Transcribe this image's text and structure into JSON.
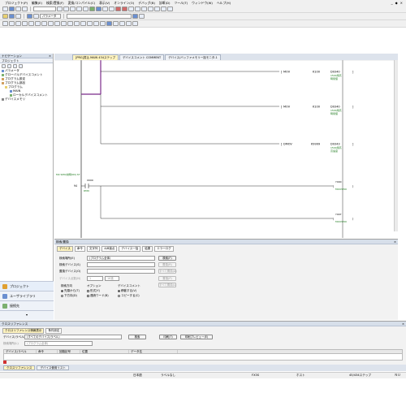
{
  "menu": [
    "プロジェクト(P)",
    "編集(E)",
    "検索/置換(F)",
    "変換/コンパイル(C)",
    "表示(V)",
    "オンライン(O)",
    "デバッグ(B)",
    "診断(D)",
    "ツール(T)",
    "ウィンドウ(W)",
    "ヘルプ(H)"
  ],
  "window_controls": [
    "_",
    "◆",
    "×"
  ],
  "toolbar": {
    "param_label": "パラメータ",
    "dropdown_empty": ""
  },
  "navigation": {
    "title": "ナビゲーション",
    "close": "×",
    "section": "プロジェクト",
    "tree": [
      {
        "label": "パラメータ",
        "level": 1
      },
      {
        "label": "グローバルデバイスコメント",
        "level": 1
      },
      {
        "label": "プログラム設定",
        "level": 1
      },
      {
        "label": "プログラム部品",
        "level": 1
      },
      {
        "label": "プログラム",
        "level": 2
      },
      {
        "label": "MAIN",
        "level": 3
      },
      {
        "label": "ローカルデバイスコメント",
        "level": 3
      },
      {
        "label": "デバイスメモリ",
        "level": 1
      }
    ],
    "buttons": [
      "プロジェクト",
      "ユーザライブラリ",
      "接続先"
    ]
  },
  "editor": {
    "tabs": [
      {
        "label": "[PRG]書込 MAIN 434ステップ",
        "active": true
      },
      {
        "label": "デバイスコメント COMMENT",
        "active": false
      },
      {
        "label": "デバイス/バッファメモリ一括モニタ-1",
        "active": false
      }
    ],
    "rungs": [
      {
        "instr": "MOV",
        "src": "K100",
        "dst": "D0340",
        "comment1": "1500用高",
        "comment2": "時間値"
      },
      {
        "instr": "MOV",
        "src": "K100",
        "dst": "D0340",
        "comment1": "1500用高",
        "comment2": "時間値"
      },
      {
        "instr": "DMOV",
        "src": "K9999",
        "dst": "D0343",
        "comment1": "1500用高",
        "comment2": "高速度"
      }
    ],
    "step_label": "M0 SM0(常時ON) ST",
    "contact_addr": "X000",
    "contact_comment": "RMO",
    "step_no": "94",
    "coil1": "Y000",
    "coil1_comment": "MOUSMO",
    "coil2": "Y007",
    "coil2_comment": "MOUSMO"
  },
  "search": {
    "title": "検索/置換",
    "close": "×",
    "tabs": [
      "デバイス",
      "命令",
      "文字列",
      "A/B接点",
      "デバイス一括",
      "結果",
      "エラーログ"
    ],
    "target_label": "検索場所(E)",
    "target_value": "(プログラム全体)",
    "find_device_label": "検索デバイス(S)",
    "replace_device_label": "置換デバイス(O)",
    "count_label": "デバイス点数(N)",
    "count_value": "1",
    "count_unit": "16進",
    "direction_label": "検索方向",
    "direction_options": [
      "先頭から(T)",
      "下方向(D)"
    ],
    "options_label": "オプション",
    "option_items": [
      "形式(Y)",
      "連続ワード(B)"
    ],
    "comment_label": "デバイスコメント",
    "comment_items": [
      "移動する(V)",
      "コピーする(C)"
    ],
    "buttons": {
      "find_next": "検索(F)",
      "replace": "置換(R)",
      "replace_all": "すべて置換(A)",
      "replace_btn2": "置換(P)",
      "replace_all2": "すべて置換(L)"
    }
  },
  "xref": {
    "title": "クロスリファレンス",
    "close": "×",
    "subtabs": [
      "クロスリファレンス情報表示",
      "条件設定"
    ],
    "device_label": "デバイス/ラベル(D)",
    "device_value": "(すべてのデバイス/ラベル)",
    "find_button": "検索",
    "print_button": "印刷(T)",
    "preview_button": "印刷プレビュー(E)",
    "place_label": "検索場所(L)",
    "place_value": "(プログラム全体)",
    "columns": [
      "デバイス/ラベル",
      "命令",
      "回路記号",
      "位置",
      "データ名"
    ]
  },
  "bottom_tabs": [
    "クロスリファレンス",
    "デバイス使用リスト"
  ],
  "status": {
    "lang": "日本語",
    "mode": "ラベルなし",
    "cpu": "FX3S",
    "host": "ホスト",
    "step": "45/434ステップ",
    "ovr": "ＮＵ"
  }
}
